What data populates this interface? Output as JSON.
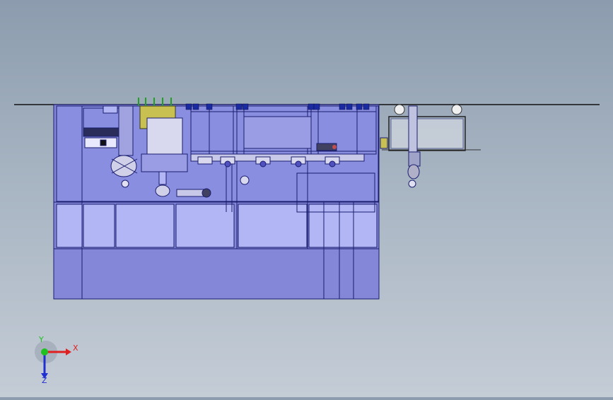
{
  "viewport": {
    "background_top": "#8c9cae",
    "background_bottom": "#c4ccd6",
    "model_fill": "#8487d8",
    "model_fill_light": "#b3b6f5",
    "model_stroke": "#1a1d6e"
  },
  "triad": {
    "x_label": "X",
    "y_label": "Y",
    "z_label": "Z",
    "x_color": "#e02020",
    "y_color": "#20c020",
    "z_color": "#2030d0"
  }
}
